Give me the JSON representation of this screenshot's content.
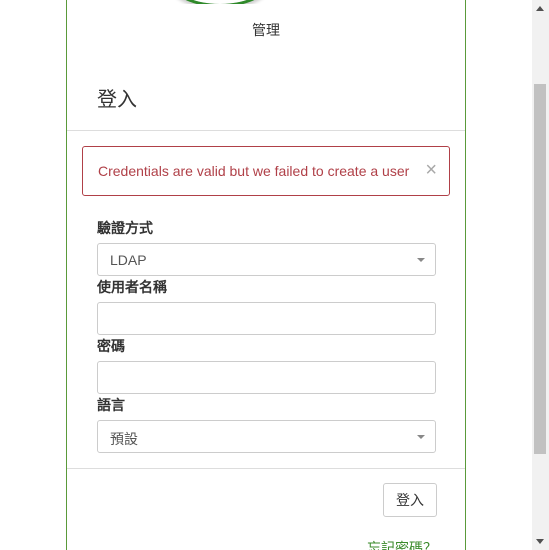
{
  "app": {
    "subtitle": "管理"
  },
  "panel": {
    "heading": "登入"
  },
  "alert": {
    "message": "Credentials are valid but we failed to create a user",
    "close_glyph": "×"
  },
  "form": {
    "auth_method": {
      "label": "驗證方式",
      "selected": "LDAP"
    },
    "username": {
      "label": "使用者名稱",
      "value": ""
    },
    "password": {
      "label": "密碼",
      "value": ""
    },
    "language": {
      "label": "語言",
      "selected": "預設"
    }
  },
  "footer": {
    "login_label": "登入",
    "forgot_password": "忘記密碼？"
  },
  "colors": {
    "brand_green": "#3a8a2a",
    "alert_red": "#b04048"
  },
  "scrollbar": {
    "scroll_position_fraction": 0.15
  }
}
